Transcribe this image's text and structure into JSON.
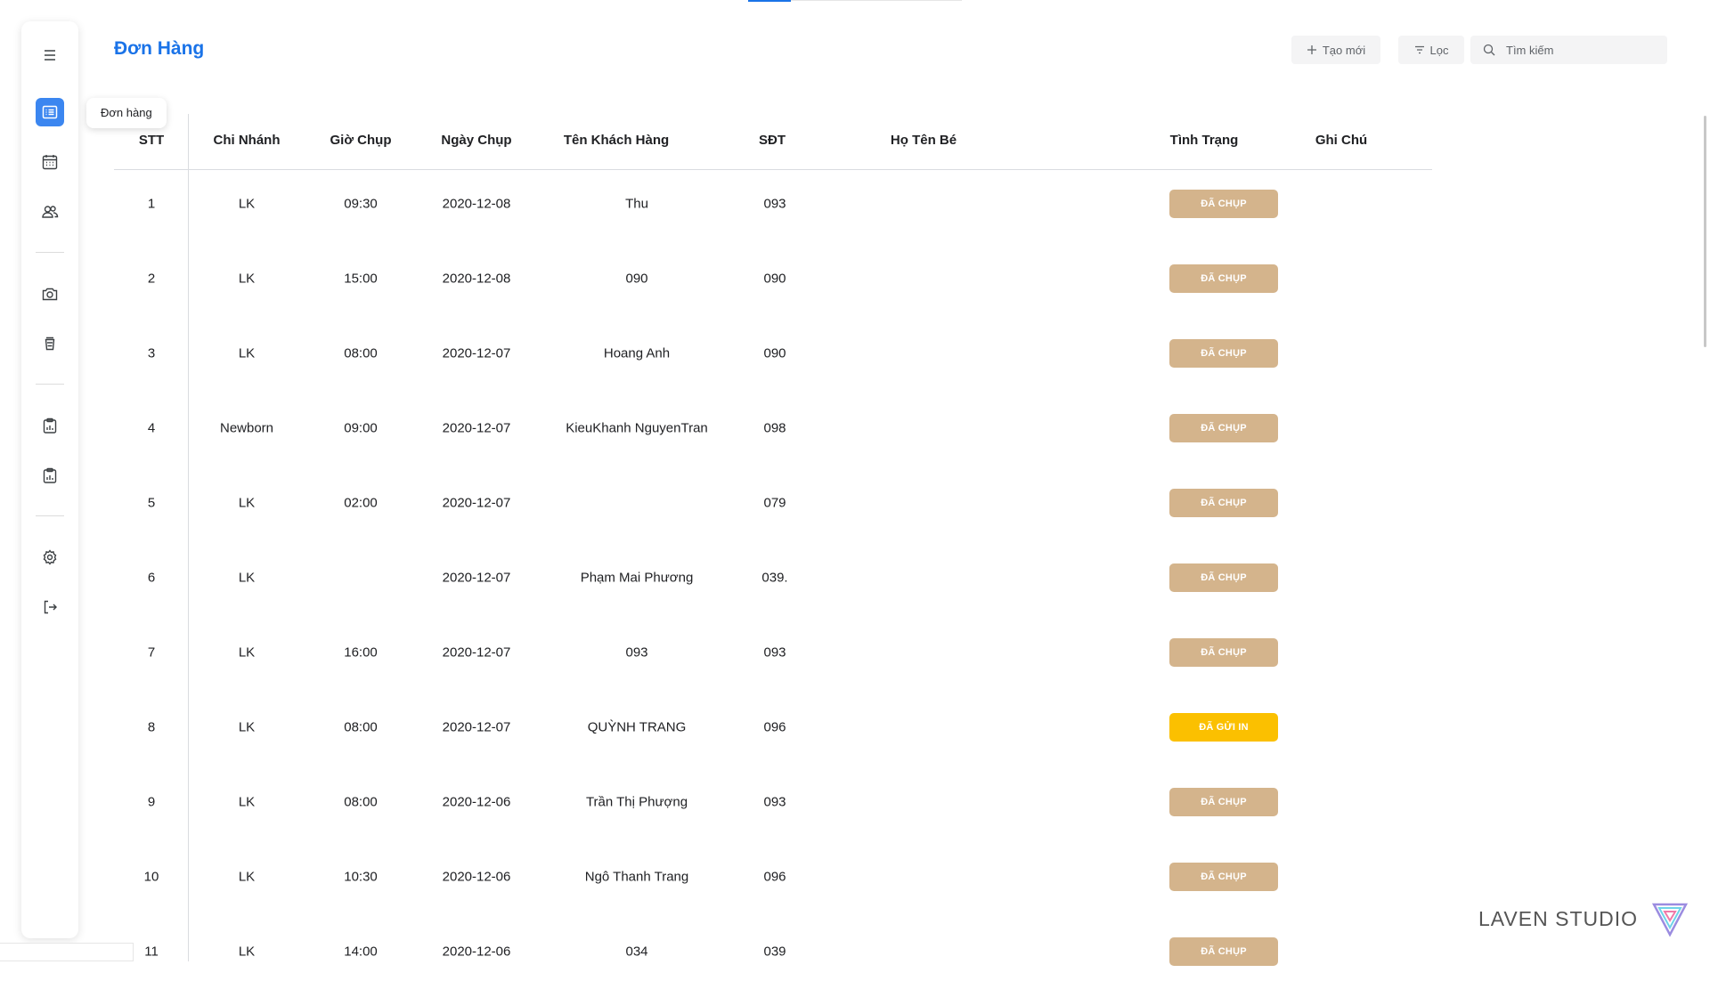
{
  "page": {
    "title": "Đơn Hàng",
    "tooltip": "Đơn hàng"
  },
  "toolbar": {
    "create_label": "Tạo mới",
    "filter_label": "Lọc",
    "search_placeholder": "Tìm kiếm"
  },
  "sidebar": {
    "items": [
      {
        "icon": "menu-icon"
      },
      {
        "icon": "list-icon",
        "active": true
      },
      {
        "icon": "calendar-icon"
      },
      {
        "icon": "users-icon"
      },
      {
        "icon": "camera-icon"
      },
      {
        "icon": "cup-icon"
      },
      {
        "icon": "report-icon"
      },
      {
        "icon": "report-icon"
      },
      {
        "icon": "gear-icon"
      },
      {
        "icon": "logout-icon"
      }
    ]
  },
  "table": {
    "headers": [
      "STT",
      "Chi Nhánh",
      "Giờ Chụp",
      "Ngày Chụp",
      "Tên Khách Hàng",
      "SĐT",
      "Họ Tên Bé",
      "Tình Trạng",
      "Ghi Chú"
    ],
    "rows": [
      {
        "stt": "1",
        "branch": "LK",
        "time": "09:30",
        "date": "2020-12-08",
        "customer": "Thu",
        "phone": "093",
        "baby": "",
        "status": "ĐÃ CHỤP",
        "note": ""
      },
      {
        "stt": "2",
        "branch": "LK",
        "time": "15:00",
        "date": "2020-12-08",
        "customer": "090",
        "phone": "090",
        "baby": "",
        "status": "ĐÃ CHỤP",
        "note": ""
      },
      {
        "stt": "3",
        "branch": "LK",
        "time": "08:00",
        "date": "2020-12-07",
        "customer": "Hoang Anh",
        "phone": "090",
        "baby": "",
        "status": "ĐÃ CHỤP",
        "note": ""
      },
      {
        "stt": "4",
        "branch": "Newborn",
        "time": "09:00",
        "date": "2020-12-07",
        "customer": "KieuKhanh NguyenTran",
        "phone": "098",
        "baby": "",
        "status": "ĐÃ CHỤP",
        "note": ""
      },
      {
        "stt": "5",
        "branch": "LK",
        "time": "02:00",
        "date": "2020-12-07",
        "customer": "",
        "phone": "079",
        "baby": "",
        "status": "ĐÃ CHỤP",
        "note": ""
      },
      {
        "stt": "6",
        "branch": "LK",
        "time": "",
        "date": "2020-12-07",
        "customer": "Phạm Mai Phương",
        "phone": "039.",
        "baby": "",
        "status": "ĐÃ CHỤP",
        "note": ""
      },
      {
        "stt": "7",
        "branch": "LK",
        "time": "16:00",
        "date": "2020-12-07",
        "customer": "093",
        "phone": "093",
        "baby": "",
        "status": "ĐÃ CHỤP",
        "note": ""
      },
      {
        "stt": "8",
        "branch": "LK",
        "time": "08:00",
        "date": "2020-12-07",
        "customer": "QUỲNH TRANG",
        "phone": "096",
        "baby": "",
        "status": "ĐÃ GỬI IN",
        "note": ""
      },
      {
        "stt": "9",
        "branch": "LK",
        "time": "08:00",
        "date": "2020-12-06",
        "customer": "Trần Thị Phượng",
        "phone": "093",
        "baby": "",
        "status": "ĐÃ CHỤP",
        "note": ""
      },
      {
        "stt": "10",
        "branch": "LK",
        "time": "10:30",
        "date": "2020-12-06",
        "customer": "Ngô Thanh Trang",
        "phone": "096",
        "baby": "",
        "status": "ĐÃ CHỤP",
        "note": ""
      },
      {
        "stt": "11",
        "branch": "LK",
        "time": "14:00",
        "date": "2020-12-06",
        "customer": "034",
        "phone": "039",
        "baby": "",
        "status": "ĐÃ CHỤP",
        "note": ""
      }
    ]
  },
  "colors": {
    "accent": "#1a73e8",
    "status_done": "#d4b48c",
    "status_sent": "#fbc000"
  },
  "brand": {
    "name": "LAVEN STUDIO"
  }
}
